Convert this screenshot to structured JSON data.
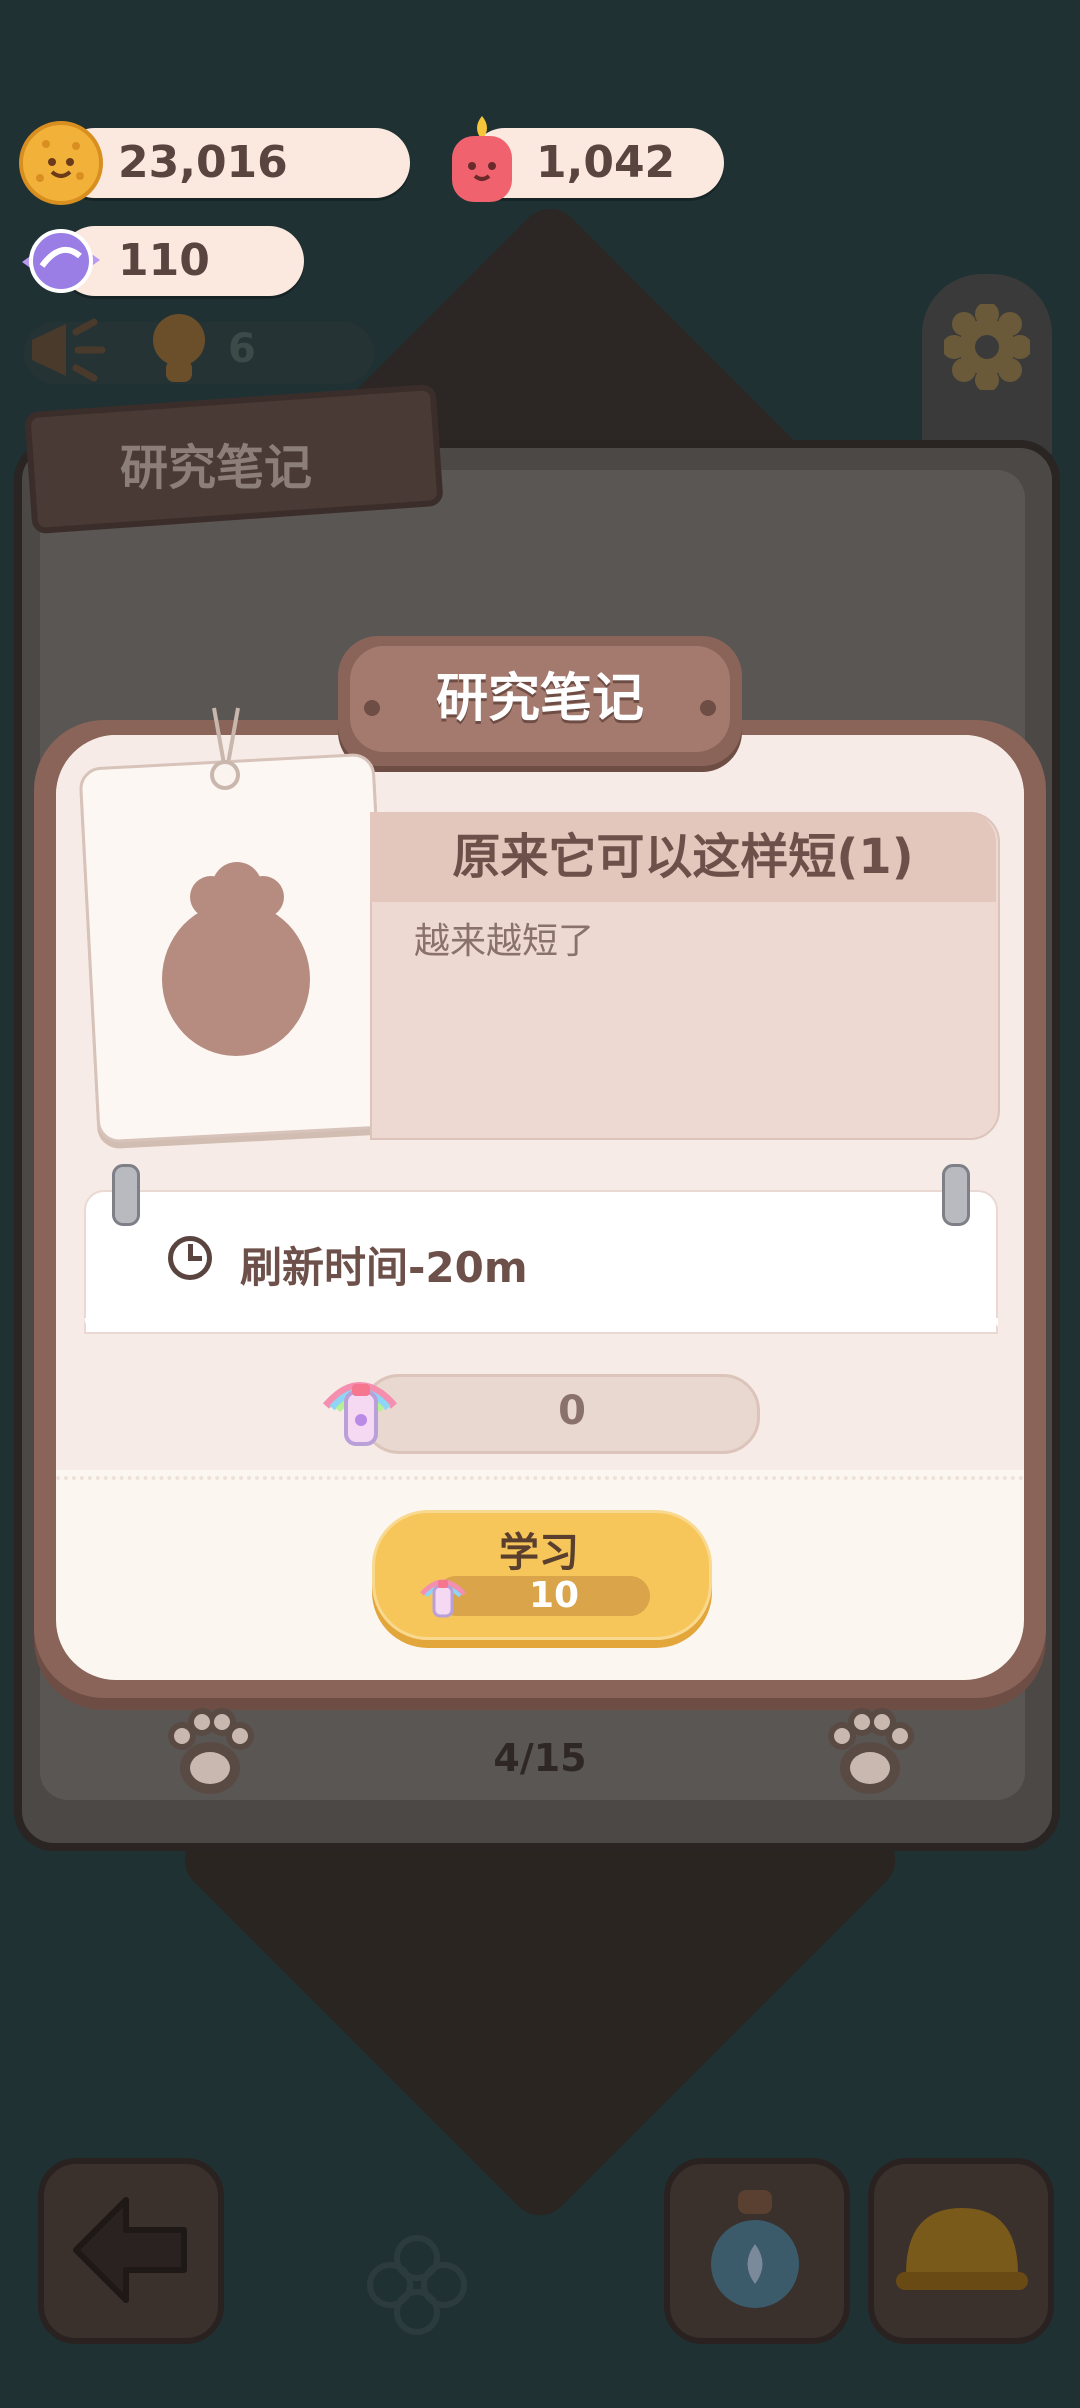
{
  "currencies": {
    "coins": "23,016",
    "candles": "1,042",
    "candy": "110",
    "helpers": "6"
  },
  "background": {
    "tab_label": "研究笔记"
  },
  "modal": {
    "title": "研究笔记",
    "recipe_title": "原来它可以这样短(1)",
    "description": "越来越短了",
    "refresh_label": "刷新时间-20m",
    "potion_count": "0",
    "learn_label": "学习",
    "learn_cost": "10"
  },
  "pager": {
    "text": "4/15"
  },
  "colors": {
    "modal_border": "#8a6459",
    "button_yellow": "#f7c65b",
    "background": "#1f3133"
  }
}
